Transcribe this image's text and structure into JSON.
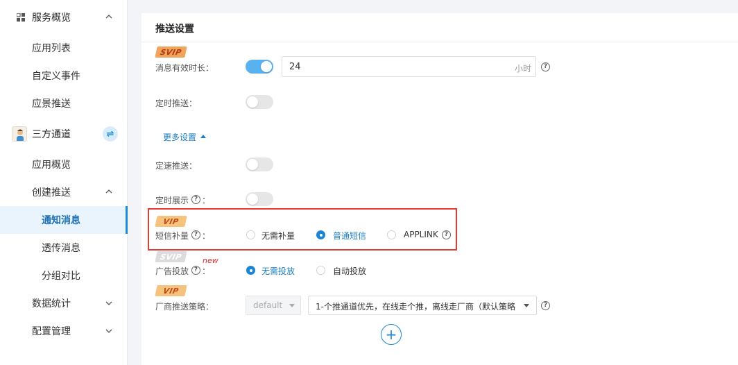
{
  "sidebar": {
    "group_overview": "服务概览",
    "item_app_list": "应用列表",
    "item_custom_event": "自定义事件",
    "item_scene_push": "应景推送",
    "group_third_party": "三方通道",
    "item_app_overview": "应用概览",
    "item_create_push": "创建推送",
    "item_notice_msg": "通知消息",
    "item_transparent_msg": "透传消息",
    "item_group_compare": "分组对比",
    "item_data_stats": "数据统计",
    "item_config": "配置管理",
    "swap_icon": "⇌"
  },
  "panel": {
    "title": "推送设置",
    "badge_svip": "SVIP",
    "badge_vip": "VIP",
    "validity_label": "消息有效时长：",
    "validity_value": "24",
    "validity_unit": "小时",
    "scheduled_label": "定时推送：",
    "more_settings": "更多设置",
    "rate_label": "定速推送：",
    "display_label": "定时展示",
    "colon": "：",
    "sms_label": "短信补量",
    "sms_options": [
      "无需补量",
      "普通短信",
      "APPLINK"
    ],
    "ad_label": "广告投放",
    "new_tag": "new",
    "ad_options": [
      "无需投放",
      "自动投放"
    ],
    "vendor_label": "厂商推送策略：",
    "vendor_default": "default",
    "vendor_strategy": "1-个推通道优先，在线走个推，离线走厂商（默认策略",
    "add_icon": "+",
    "help_icon": "?"
  },
  "colors": {
    "accent": "#1a84d6",
    "toggle_on": "#5ab1ef",
    "highlight": "#e53935",
    "active_bg": "#e9f4fc"
  }
}
